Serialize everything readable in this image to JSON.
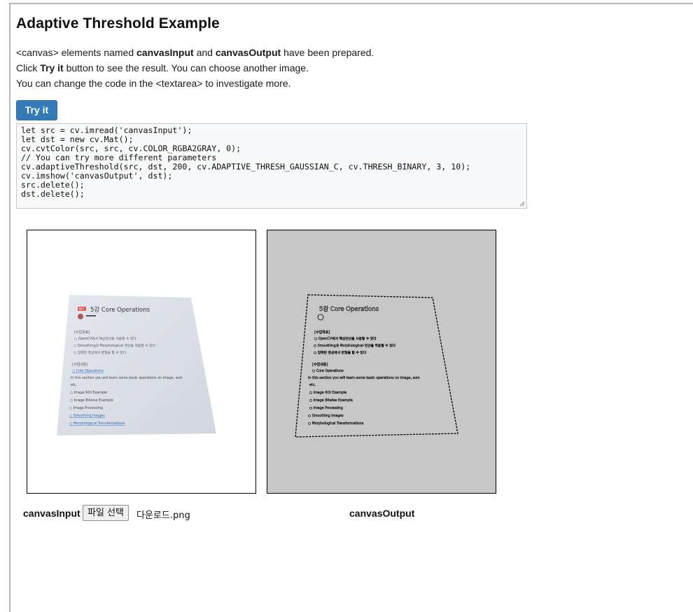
{
  "page": {
    "title": "Adaptive Threshold Example",
    "line1": {
      "pre": "<canvas> elements named ",
      "b1": "canvasInput",
      "mid": " and ",
      "b2": "canvasOutput",
      "post": " have been prepared."
    },
    "line2": {
      "pre": "Click ",
      "b": "Try it",
      "post": " button to see the result. You can choose another image."
    },
    "line3": "You can change the code in the <textarea> to investigate more."
  },
  "try_button": "Try it",
  "code": "let src = cv.imread('canvasInput');\nlet dst = new cv.Mat();\ncv.cvtColor(src, src, cv.COLOR_RGBA2GRAY, 0);\n// You can try more different parameters\ncv.adaptiveThreshold(src, dst, 200, cv.ADAPTIVE_THRESH_GAUSSIAN_C, cv.THRESH_BINARY, 3, 10);\ncv.imshow('canvasOutput', dst);\nsrc.delete();\ndst.delete();",
  "input_doc": {
    "chapter_tag": "챕터",
    "heading": "5강 Core Operations",
    "goals_title": "[수업목표]",
    "goals": [
      "OpenCV에서 핵심연산을 사용할 수 있다",
      "Smoothing과 Morphological 연산을 적용할 수 있다",
      "입력된 영상에서 변형을 할 수 있다"
    ],
    "content_title": "[수업내용]",
    "link": "Core Operations",
    "para": "In this section you will learn some basic operations on image, som",
    "etc": "etc.",
    "items": [
      "Image ROI Example",
      "Image Bitwise Example",
      "Image Processing",
      "Smoothing Images",
      "Morphological Transformations"
    ]
  },
  "labels": {
    "canvas_input": "canvasInput",
    "canvas_output": "canvasOutput",
    "file_button": "파일 선택",
    "file_name": "다운로드.png"
  },
  "colors": {
    "button": "#337ab7",
    "output_bg": "#c7c7c7"
  }
}
